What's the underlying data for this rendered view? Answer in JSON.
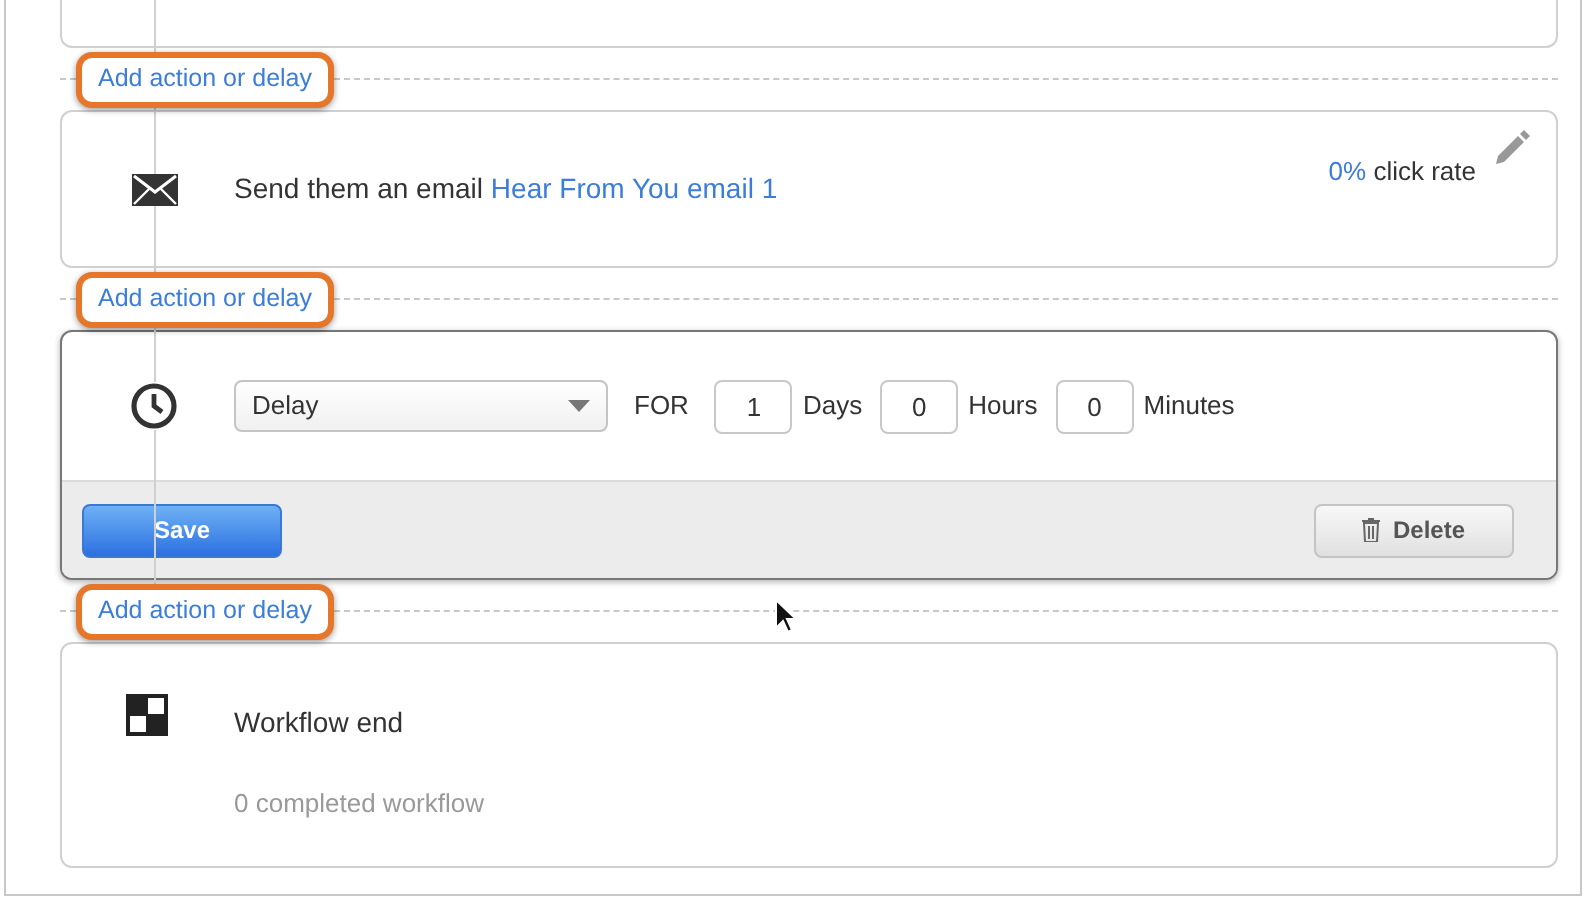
{
  "flow": [
    {
      "kind": "stub"
    },
    {
      "kind": "add",
      "label": "Add action or delay",
      "highlighted": true
    },
    {
      "kind": "email",
      "text": "Send them an email",
      "link": "Hear From You email 1",
      "rate": "0%",
      "rate_label": "click rate"
    },
    {
      "kind": "add",
      "label": "Add action or delay",
      "highlighted": true
    },
    {
      "kind": "delay",
      "select": "Delay",
      "for_label": "FOR",
      "fields": [
        {
          "value": "1",
          "unit": "Days"
        },
        {
          "value": "0",
          "unit": "Hours"
        },
        {
          "value": "0",
          "unit": "Minutes"
        }
      ],
      "save": "Save",
      "delete": "Delete"
    },
    {
      "kind": "add",
      "label": "Add action or delay",
      "highlighted": true
    },
    {
      "kind": "end",
      "title": "Workflow end",
      "subtitle": "0 completed workflow"
    }
  ]
}
